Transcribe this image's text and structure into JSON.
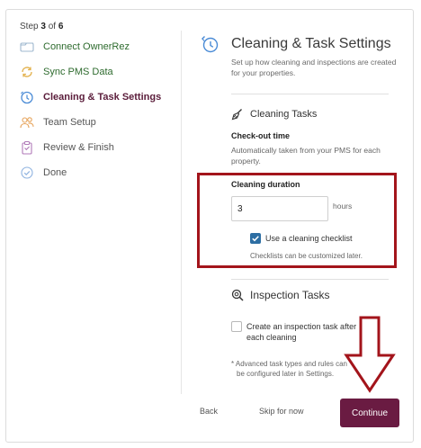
{
  "progress": {
    "label_prefix": "Step",
    "current": "3",
    "label_mid": "of",
    "total": "6"
  },
  "steps": [
    {
      "label": "Connect OwnerRez",
      "state": "done",
      "icon": "link-icon"
    },
    {
      "label": "Sync PMS Data",
      "state": "done",
      "icon": "sync-icon"
    },
    {
      "label": "Cleaning & Task Settings",
      "state": "active",
      "icon": "clock-icon"
    },
    {
      "label": "Team Setup",
      "state": "pending",
      "icon": "team-icon"
    },
    {
      "label": "Review & Finish",
      "state": "pending",
      "icon": "clipboard-icon"
    },
    {
      "label": "Done",
      "state": "pending",
      "icon": "check-circle-icon"
    }
  ],
  "header": {
    "title": "Cleaning & Task Settings",
    "subtitle": "Set up how cleaning and inspections are created for your properties."
  },
  "cleaning": {
    "heading": "Cleaning Tasks",
    "checkout_label": "Check-out time",
    "checkout_help": "Automatically taken from your PMS for each property.",
    "duration_label": "Cleaning duration",
    "duration_value": "3",
    "duration_unit": "hours",
    "checklist_label": "Use a cleaning checklist",
    "checklist_checked": true,
    "checklist_note": "Checklists can be customized later."
  },
  "inspection": {
    "heading": "Inspection Tasks",
    "option_line1": "Create an inspection task after",
    "option_line2": "each cleaning",
    "option_checked": false,
    "note_line1": "* Advanced task types and rules can",
    "note_line2": "be configured later in Settings."
  },
  "footer": {
    "back": "Back",
    "skip": "Skip for now",
    "continue": "Continue"
  },
  "colors": {
    "brand": "#6a1b42",
    "done": "#2e6b2e",
    "active": "#5a1c3a",
    "highlight": "#a3141b",
    "check": "#2d6ea3"
  }
}
